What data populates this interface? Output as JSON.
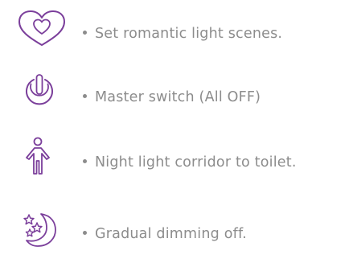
{
  "accent_color": "#7b3f9b",
  "text_color": "#8c8c8c",
  "features": [
    {
      "icon": "heart-icon",
      "bullet": "•",
      "label": "Set romantic light scenes."
    },
    {
      "icon": "power-icon",
      "bullet": "•",
      "label": "Master switch (All OFF)"
    },
    {
      "icon": "person-walking-icon",
      "bullet": "•",
      "label": "Night light corridor to toilet."
    },
    {
      "icon": "moon-stars-icon",
      "bullet": "•",
      "label": "Gradual dimming off."
    }
  ]
}
